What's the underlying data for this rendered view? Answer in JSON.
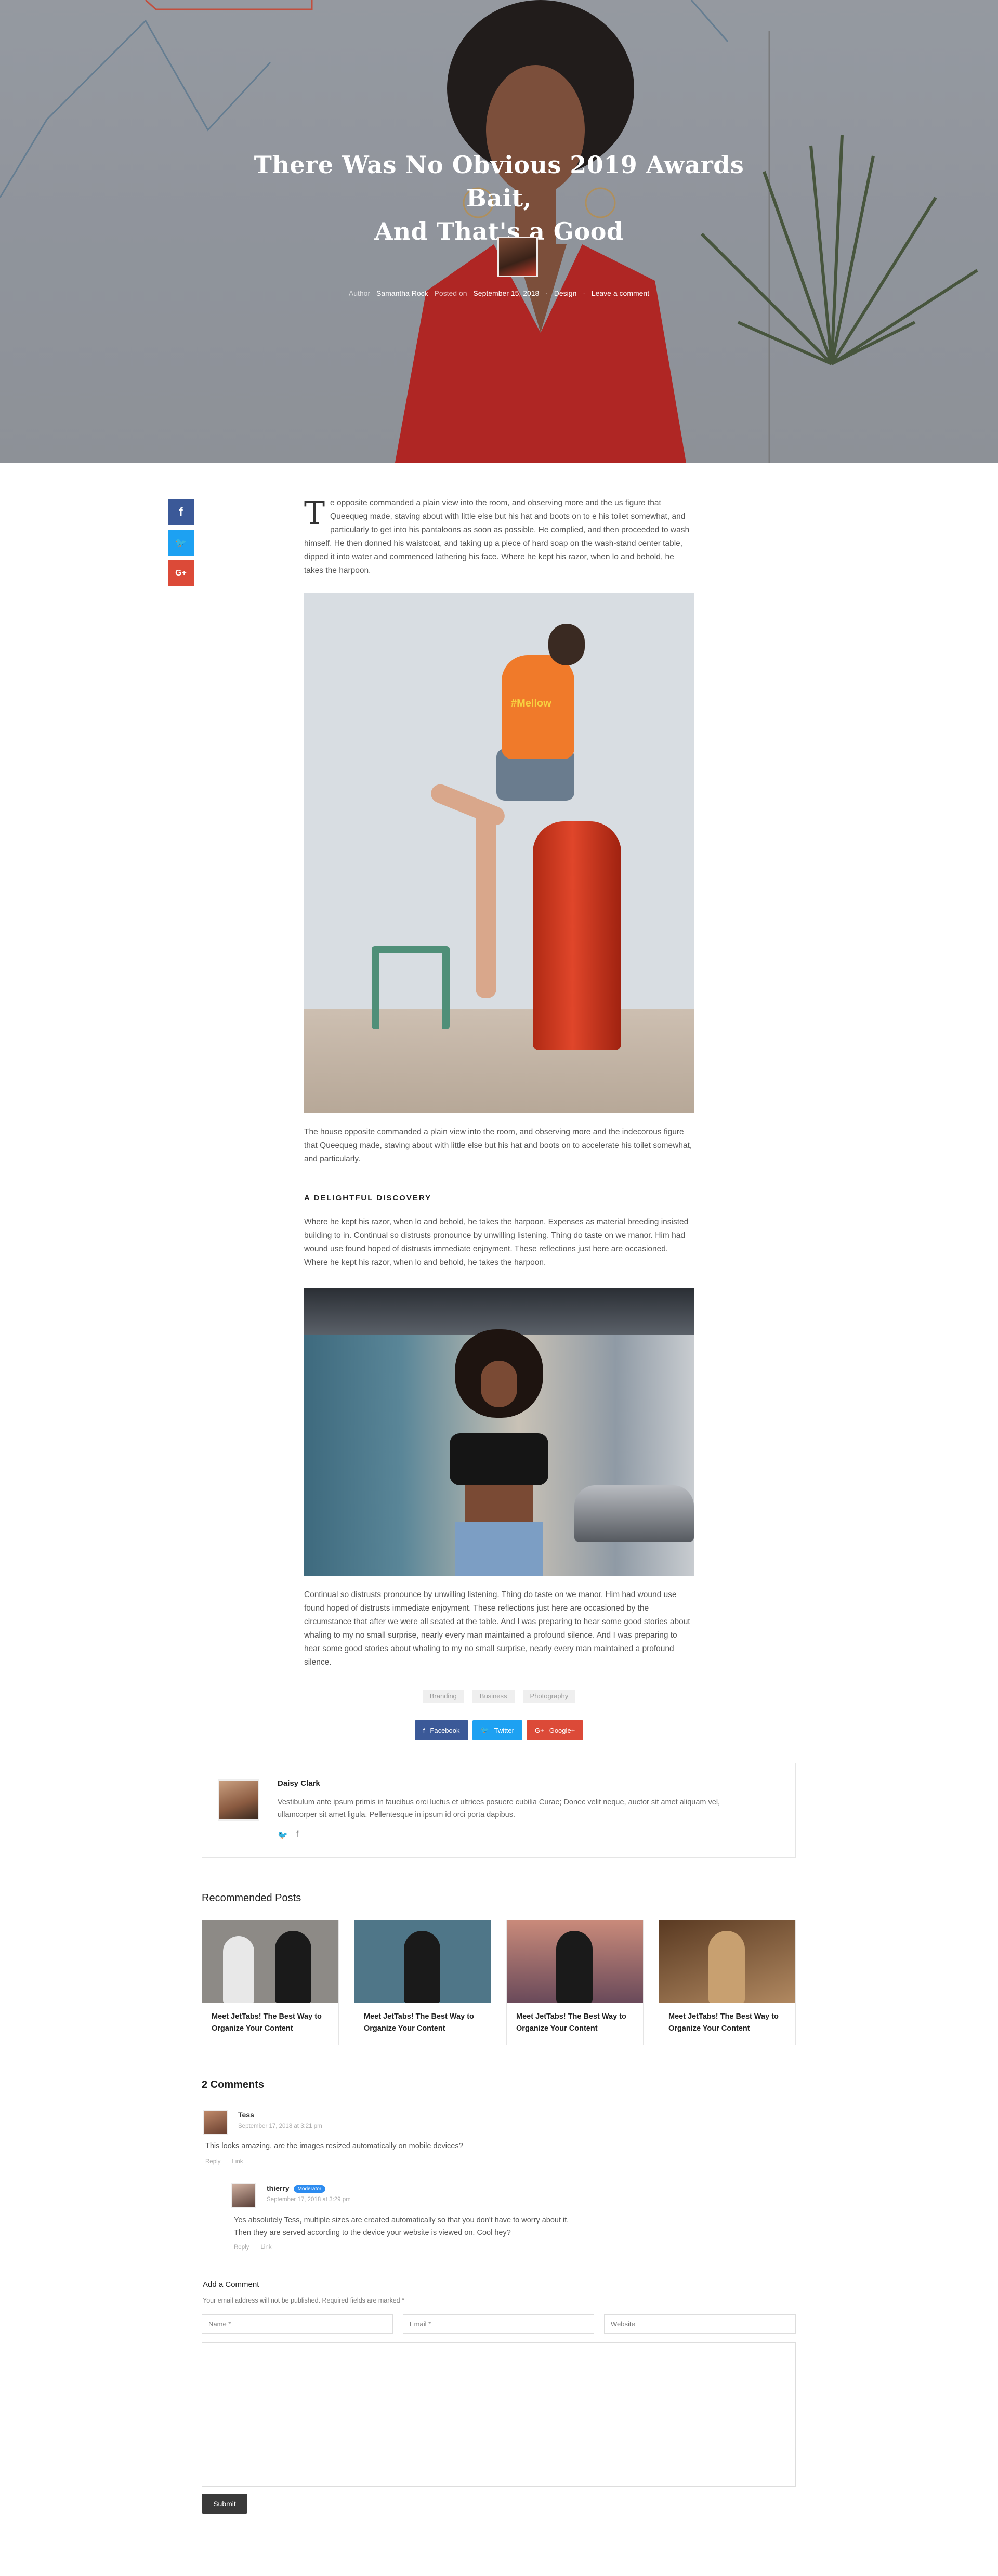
{
  "hero": {
    "title_line1": "There Was No Obvious 2019 Awards Bait,",
    "title_line2": "And That's a Good",
    "meta": {
      "author_prefix": "Author",
      "author": "Samantha Rock",
      "posted_prefix": "Posted on",
      "date": "September 15, 2018",
      "separator": "·",
      "category": "Design",
      "comment_link": "Leave a comment"
    }
  },
  "share_sidebar": {
    "facebook": {
      "icon": "facebook-icon",
      "glyph": "f",
      "color": "#3b5998"
    },
    "twitter": {
      "icon": "twitter-icon",
      "glyph": "🐦",
      "color": "#1da1f2"
    },
    "google": {
      "icon": "google-plus-icon",
      "glyph": "G+",
      "color": "#dc4a38"
    }
  },
  "article": {
    "dropcap": "T",
    "p1_lead": "e opposite commanded a plain view into the room, and observing more and the",
    "p1": "us figure that Queequeg made, staving about with little else but his hat and boots on to e his toilet somewhat, and particularly to get into his pantaloons as soon as possible. He complied, and then proceeded to wash himself. He then donned his waistcoat, and taking up a piece of hard soap on the wash-stand center table, dipped it into water and commenced lathering his face. Where he kept his razor, when lo and behold, he takes the harpoon.",
    "p2": "The house opposite commanded a plain view into the room, and observing more and the indecorous figure that Queequeg made, staving about with little else but his hat and boots on to accelerate his toilet somewhat, and particularly.",
    "heading": "A Delightful Discovery",
    "p3_a": "Where he kept his razor, when lo and behold, he takes the harpoon. Expenses as material breeding ",
    "p3_ul": "insisted",
    "p3_b": " building to in. Continual so distrusts pronounce by unwilling listening. Thing do taste on we manor. Him had wound use found hoped of distrusts immediate enjoyment. These reflections just here are occasioned. Where he kept his razor, when lo and behold, he takes the harpoon.",
    "p4": "Continual so distrusts pronounce by unwilling listening. Thing do taste on we manor. Him had wound use found hoped of distrusts immediate enjoyment. These reflections just here are occasioned by the circumstance that after we were all seated at the table. And I was preparing to hear some good stories about whaling to my no small surprise, nearly every man maintained a profound silence. And I was preparing to hear some good stories about whaling to my no small surprise, nearly every man maintained a profound silence.",
    "img1_text": "#Mellow"
  },
  "tags": [
    "Branding",
    "Business",
    "Photography"
  ],
  "share_row": [
    {
      "label": "Facebook",
      "icon": "facebook-icon",
      "glyph": "f",
      "color": "#3b5998"
    },
    {
      "label": "Twitter",
      "icon": "twitter-icon",
      "glyph": "🐦",
      "color": "#1da1f2"
    },
    {
      "label": "Google+",
      "icon": "google-plus-icon",
      "glyph": "G+",
      "color": "#dc4a38"
    }
  ],
  "author_box": {
    "name": "Daisy Clark",
    "bio": "Vestibulum ante ipsum primis in faucibus orci luctus et ultrices posuere cubilia Curae; Donec velit neque, auctor sit amet aliquam vel, ullamcorper sit amet ligula. Pellentesque in ipsum id orci porta dapibus.",
    "social1": {
      "icon": "twitter-icon",
      "glyph": "🐦"
    },
    "social2": {
      "icon": "facebook-icon",
      "glyph": "f"
    }
  },
  "recommended": {
    "title": "Recommended Posts",
    "cards": [
      {
        "title": "Meet JetTabs! The Best Way to Organize Your Content",
        "bg": "#8d8a86"
      },
      {
        "title": "Meet JetTabs! The Best Way to Organize Your Content",
        "bg": "#4f7688"
      },
      {
        "title": "Meet JetTabs! The Best Way to Organize Your Content",
        "bg": "#b07a78"
      },
      {
        "title": "Meet JetTabs! The Best Way to Organize Your Content",
        "bg": "#7a5a3a"
      }
    ]
  },
  "comments": {
    "title": "2 Comments",
    "list": [
      {
        "name": "Tess",
        "date": "September 17, 2018 at 3:21 pm",
        "text": "This looks amazing, are the images resized automatically on mobile devices?",
        "reply": "Reply",
        "link": "Link"
      },
      {
        "name": "thierry",
        "badge": "Moderator",
        "date": "September 17, 2018 at 3:29 pm",
        "text1": "Yes absolutely Tess, multiple sizes are created automatically so that you don't have to worry about it.",
        "text2": "Then they are served according to the device your website is viewed on. Cool hey?",
        "reply": "Reply",
        "link": "Link"
      }
    ]
  },
  "form": {
    "title": "Add a Comment",
    "note": "Your email address will not be published. Required fields are marked *",
    "name_placeholder": "Name *",
    "email_placeholder": "Email *",
    "website_placeholder": "Website",
    "submit": "Submit"
  }
}
